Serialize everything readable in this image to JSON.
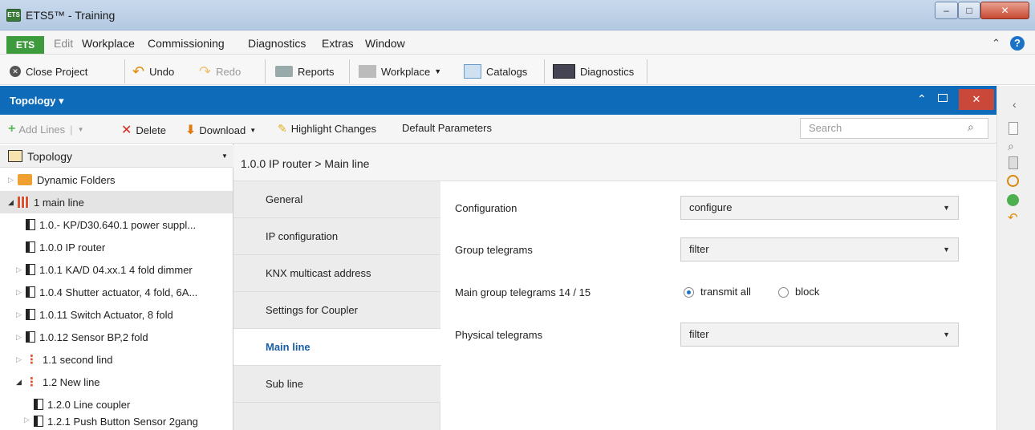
{
  "window": {
    "title": "ETS5™ - Training",
    "app_icon": "ETS"
  },
  "menubar": {
    "ets_tab": "ETS",
    "items": [
      "Edit",
      "Workplace",
      "Commissioning",
      "Diagnostics",
      "Extras",
      "Window"
    ]
  },
  "toolbar": {
    "close_project": "Close Project",
    "undo": "Undo",
    "redo": "Redo",
    "reports": "Reports",
    "workplace": "Workplace",
    "catalogs": "Catalogs",
    "diagnostics": "Diagnostics"
  },
  "panel": {
    "title": "Topology ▾"
  },
  "actions": {
    "add_lines": "Add Lines",
    "delete": "Delete",
    "download": "Download",
    "highlight": "Highlight Changes",
    "default_params": "Default Parameters",
    "search_placeholder": "Search"
  },
  "tree": {
    "header": "Topology",
    "items": [
      {
        "label": "Dynamic Folders"
      },
      {
        "label": "1 main line"
      },
      {
        "label": "1.0.- KP/D30.640.1 power suppl..."
      },
      {
        "label": "1.0.0 IP router"
      },
      {
        "label": "1.0.1 KA/D 04.xx.1 4 fold dimmer"
      },
      {
        "label": "1.0.4 Shutter actuator, 4 fold, 6A..."
      },
      {
        "label": "1.0.11 Switch Actuator, 8 fold"
      },
      {
        "label": "1.0.12 Sensor BP,2 fold"
      },
      {
        "label": "1.1 second lind"
      },
      {
        "label": "1.2 New line"
      },
      {
        "label": "1.2.0 Line coupler"
      },
      {
        "label": "1.2.1 Push Button Sensor 2gang"
      }
    ]
  },
  "breadcrumb": "1.0.0 IP router > Main line",
  "param_nav": [
    "General",
    "IP configuration",
    "KNX multicast address",
    "Settings for Coupler",
    "Main line",
    "Sub line"
  ],
  "params": {
    "configuration": {
      "label": "Configuration",
      "value": "configure"
    },
    "group_telegrams": {
      "label": "Group telegrams",
      "value": "filter"
    },
    "main_group": {
      "label": "Main group telegrams 14 / 15",
      "opt1": "transmit all",
      "opt2": "block"
    },
    "physical": {
      "label": "Physical telegrams",
      "value": "filter"
    }
  }
}
